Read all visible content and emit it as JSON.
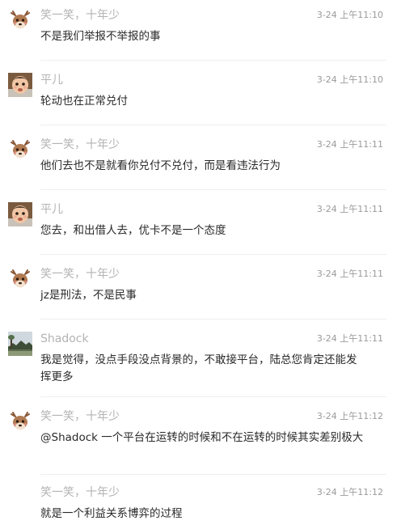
{
  "messages": [
    {
      "avatar": "deer-avatar",
      "sender": "笑一笑，十年少",
      "time": "3-24 上午11:10",
      "text": "不是我们举报不举报的事"
    },
    {
      "avatar": "baby-avatar",
      "sender": "平儿",
      "time": "3-24 上午11:10",
      "text": "轮动也在正常兑付"
    },
    {
      "avatar": "deer-avatar",
      "sender": "笑一笑，十年少",
      "time": "3-24 上午11:11",
      "text": "他们去也不是就看你兑付不兑付，而是看违法行为"
    },
    {
      "avatar": "baby-avatar",
      "sender": "平儿",
      "time": "3-24 上午11:11",
      "text": "您去，和出借人去，优卡不是一个态度"
    },
    {
      "avatar": "deer-avatar",
      "sender": "笑一笑，十年少",
      "time": "3-24 上午11:11",
      "text": "jz是刑法，不是民事"
    },
    {
      "avatar": "landscape-avatar",
      "sender": "Shadock",
      "time": "3-24 上午11:11",
      "text": "我是觉得，没点手段没点背景的，不敢接平台，陆总您肯定还能发挥更多"
    },
    {
      "avatar": "deer-avatar",
      "sender": "笑一笑，十年少",
      "time": "3-24 上午11:12",
      "text": "@Shadock 一个平台在运转的时候和不在运转的时候其实差别极大"
    },
    {
      "avatar": "",
      "sender": "笑一笑，十年少",
      "time": "3-24 上午11:12",
      "text": "就是一个利益关系博弈的过程"
    }
  ]
}
